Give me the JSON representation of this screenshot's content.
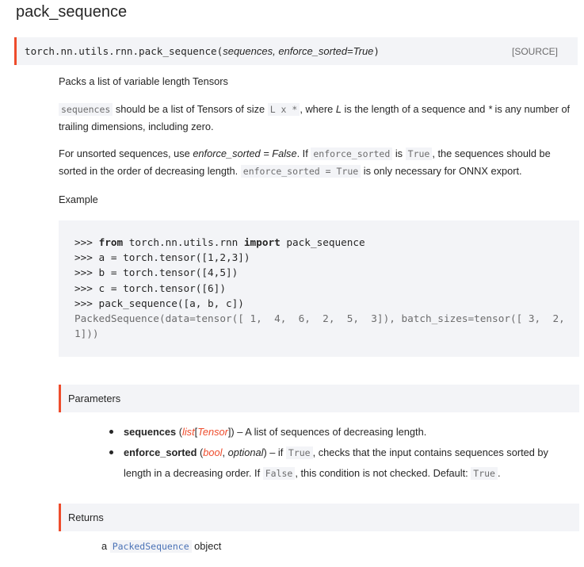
{
  "title": "pack_sequence",
  "signature": {
    "name": "torch.nn.utils.rnn.pack_sequence(",
    "params": "sequences, enforce_sorted=True",
    "close": ")",
    "source_label": "[SOURCE]"
  },
  "description": "Packs a list of variable length Tensors",
  "para1": {
    "code1": "sequences",
    "text1": " should be a list of Tensors of size ",
    "code2": "L x *",
    "text2": ", where ",
    "em1": "L",
    "text3": " is the length of a sequence and ",
    "em2": "*",
    "text4": " is any number of trailing dimensions, including zero."
  },
  "para2": {
    "text1": "For unsorted sequences, use ",
    "em1": "enforce_sorted = False",
    "text2": ". If ",
    "code1": "enforce_sorted",
    "text3": " is ",
    "code2": "True",
    "text4": ", the sequences should be sorted in the order of decreasing length. ",
    "code3": "enforce_sorted = True",
    "text5": " is only necessary for ONNX export."
  },
  "example_label": "Example",
  "code": {
    "l1_prompt": ">>> ",
    "l1_kw1": "from",
    "l1_mid": " torch.nn.utils.rnn ",
    "l1_kw2": "import",
    "l1_end": " pack_sequence",
    "l2": ">>> a = torch.tensor([1,2,3])",
    "l3": ">>> b = torch.tensor([4,5])",
    "l4": ">>> c = torch.tensor([6])",
    "l5": ">>> pack_sequence([a, b, c])",
    "l6": "PackedSequence(data=tensor([ 1,  4,  6,  2,  5,  3]), batch_sizes=tensor([ 3,  2,",
    "l7": "1]))"
  },
  "parameters": {
    "header": "Parameters",
    "items": [
      {
        "name": "sequences",
        "type_open": " (",
        "type1": "list",
        "br_open": "[",
        "type2": "Tensor",
        "br_close": "])",
        "desc": " – A list of sequences of decreasing length."
      },
      {
        "name": "enforce_sorted",
        "type_open": " (",
        "type1": "bool",
        "sep": ", ",
        "type2": "optional",
        "close": ")",
        "desc1": " – if ",
        "code1": "True",
        "desc2": ", checks that the input contains sequences sorted by length in a decreasing order. If ",
        "code2": "False",
        "desc3": ", this condition is not checked. Default: ",
        "code3": "True",
        "desc4": "."
      }
    ]
  },
  "returns": {
    "header": "Returns",
    "prefix": "a ",
    "code": "PackedSequence",
    "suffix": " object"
  },
  "colors": {
    "accent": "#ee4c2c",
    "panel": "#f3f4f7",
    "link": "#4a72b6"
  }
}
